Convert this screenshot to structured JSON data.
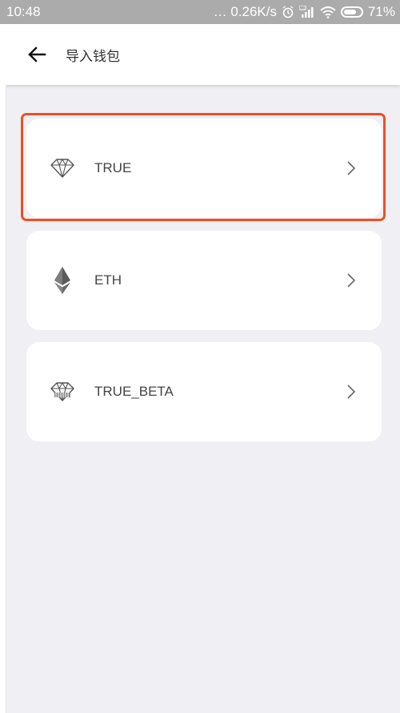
{
  "status_bar": {
    "time": "10:48",
    "network_speed": "… 0.26K/s",
    "battery": "71%",
    "icons": [
      "alarm-icon",
      "signal-icon",
      "wifi-icon",
      "battery-icon"
    ]
  },
  "header": {
    "title": "导入钱包",
    "back_icon": "arrow-left-icon"
  },
  "wallet_list": {
    "items": [
      {
        "label": "TRUE",
        "icon": "diamond-outline-icon",
        "selected": true
      },
      {
        "label": "ETH",
        "icon": "ethereum-icon",
        "selected": false
      },
      {
        "label": "TRUE_BETA",
        "icon": "diamond-striped-icon",
        "selected": false
      }
    ]
  },
  "colors": {
    "accent_highlight": "#f04e23",
    "background": "#f0eff4",
    "card": "#ffffff",
    "status_bar": "#ababab"
  }
}
